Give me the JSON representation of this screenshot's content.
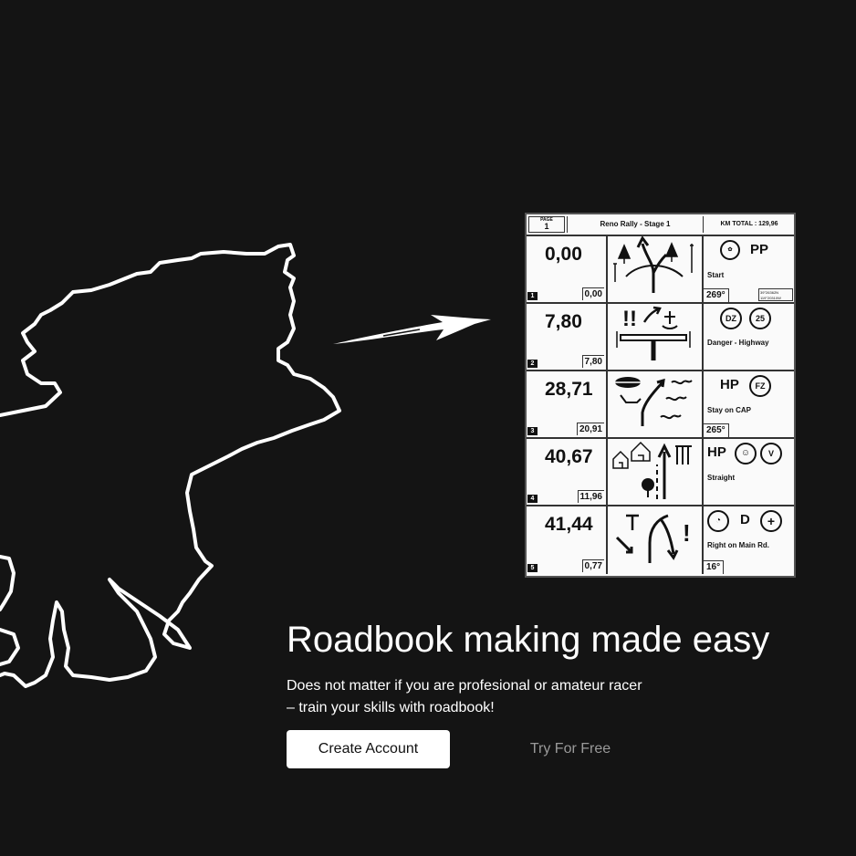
{
  "hero": {
    "headline": "Roadbook making made easy",
    "subtitle_line1": "Does not matter if you are profesional or amateur racer",
    "subtitle_line2": "– train your skills with roadbook!",
    "primary_button": "Create Account",
    "secondary_button": "Try For Free"
  },
  "roadbook": {
    "page_label": "PAGE",
    "page_number": "1",
    "title": "Reno Rally - Stage 1",
    "km_total": "KM TOTAL : 129,96",
    "rows": [
      {
        "index": "1",
        "km": "0,00",
        "partial": "0,00",
        "code": "PP",
        "note": "Start",
        "cap": "269°",
        "coords": "39°26362N\n119°20310W"
      },
      {
        "index": "2",
        "km": "7,80",
        "partial": "7,80",
        "badge1": "DZ",
        "badge2": "25",
        "note": "Danger - Highway",
        "cap": ""
      },
      {
        "index": "3",
        "km": "28,71",
        "partial": "20,91",
        "code": "HP",
        "badge1": "FZ",
        "note": "Stay on CAP",
        "cap": "265°"
      },
      {
        "index": "4",
        "km": "40,67",
        "partial": "11,96",
        "code": "HP",
        "badge2": "V",
        "note": "Straight",
        "cap": ""
      },
      {
        "index": "5",
        "km": "41,44",
        "partial": "0,77",
        "code": "D",
        "note": "Right on Main Rd.",
        "cap": "16°"
      }
    ]
  },
  "colors": {
    "background": "#141414",
    "text": "#ffffff",
    "muted_link": "#9a9a9a",
    "button_bg": "#ffffff"
  },
  "icons": [
    "route-map-icon",
    "brush-arrow-icon",
    "tree-icon",
    "house-icon",
    "warning-icon"
  ]
}
